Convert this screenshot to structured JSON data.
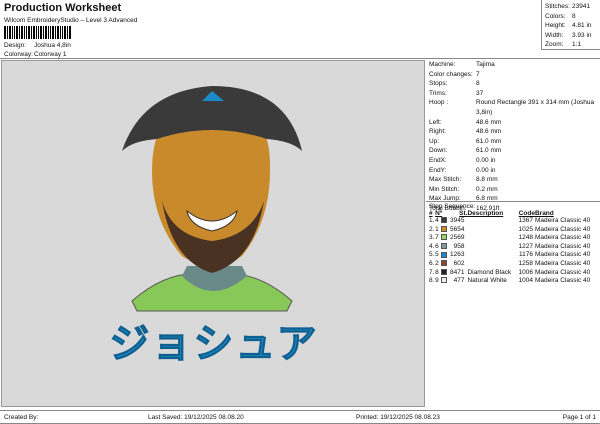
{
  "header": {
    "title": "Production Worksheet",
    "subtitle": "Wilcom EmbroideryStudio – Level 3 Advanced",
    "design_label": "Design:",
    "design_value": "Joshua 4,8in",
    "colorway_label": "Colorway:",
    "colorway_value": "Colorway 1"
  },
  "stats": [
    {
      "label": "Stitches:",
      "value": "23941"
    },
    {
      "label": "Colors:",
      "value": "8"
    },
    {
      "label": "Height:",
      "value": "4.81 in"
    },
    {
      "label": "Width:",
      "value": "3.93 in"
    },
    {
      "label": "Zoom:",
      "value": "1:1"
    }
  ],
  "info": [
    {
      "label": "Machine:",
      "value": "Tajima"
    },
    {
      "label": "Color changes:",
      "value": "7"
    },
    {
      "label": "Stops:",
      "value": "8"
    },
    {
      "label": "Trims:",
      "value": "37"
    },
    {
      "label": "Hoop :",
      "value": "Round Rectangle 391 x 314 mm (Joshua 3,8in)"
    },
    {
      "label": "Left:",
      "value": "48.6 mm"
    },
    {
      "label": "Right:",
      "value": "48.6 mm"
    },
    {
      "label": "Up:",
      "value": "61.0 mm"
    },
    {
      "label": "Down:",
      "value": "61.0 mm"
    },
    {
      "label": "EndX:",
      "value": "0.00 in"
    },
    {
      "label": "EndY:",
      "value": "0.00 in"
    },
    {
      "label": "Max Stitch:",
      "value": "8.8 mm"
    },
    {
      "label": "Min Stitch:",
      "value": "0.2 mm"
    },
    {
      "label": "Max Jump:",
      "value": "6.8 mm"
    },
    {
      "label": "Total Bobbin:",
      "value": "162.91ft"
    }
  ],
  "stop_sequence": {
    "title": "Stop Sequence:",
    "headers": [
      "#",
      "Nº",
      "St.",
      "Description",
      "Code",
      "Brand"
    ],
    "rows": [
      {
        "n": "1.",
        "no": "4",
        "color": "#3a3a3a",
        "st": "3945",
        "desc": "",
        "code": "1367",
        "brand": "Madeira Classic 40"
      },
      {
        "n": "2.",
        "no": "1",
        "color": "#d4862a",
        "st": "5654",
        "desc": "",
        "code": "1025",
        "brand": "Madeira Classic 40"
      },
      {
        "n": "3.",
        "no": "7",
        "color": "#98d466",
        "st": "2569",
        "desc": "",
        "code": "1248",
        "brand": "Madeira Classic 40"
      },
      {
        "n": "4.",
        "no": "6",
        "color": "#7f9c9c",
        "st": "958",
        "desc": "",
        "code": "1227",
        "brand": "Madeira Classic 40"
      },
      {
        "n": "5.",
        "no": "5",
        "color": "#1a8ac8",
        "st": "1263",
        "desc": "",
        "code": "1176",
        "brand": "Madeira Classic 40"
      },
      {
        "n": "6.",
        "no": "2",
        "color": "#8a4a2e",
        "st": "602",
        "desc": "",
        "code": "1258",
        "brand": "Madeira Classic 40"
      },
      {
        "n": "7.",
        "no": "8",
        "color": "#222222",
        "st": "8471",
        "desc": "Diamond Black",
        "code": "1006",
        "brand": "Madeira Classic 40"
      },
      {
        "n": "8.",
        "no": "9",
        "color": "#eeeeee",
        "st": "477",
        "desc": "Natural White",
        "code": "1004",
        "brand": "Madeira Classic 40"
      }
    ]
  },
  "design_lettering": "ジョシュア",
  "footer": {
    "created": "Created By:",
    "saved": "Last Saved: 19/12/2025 08.08.20",
    "printed": "Printed: 19/12/2025 08.08.23",
    "page": "Page 1 of 1"
  }
}
